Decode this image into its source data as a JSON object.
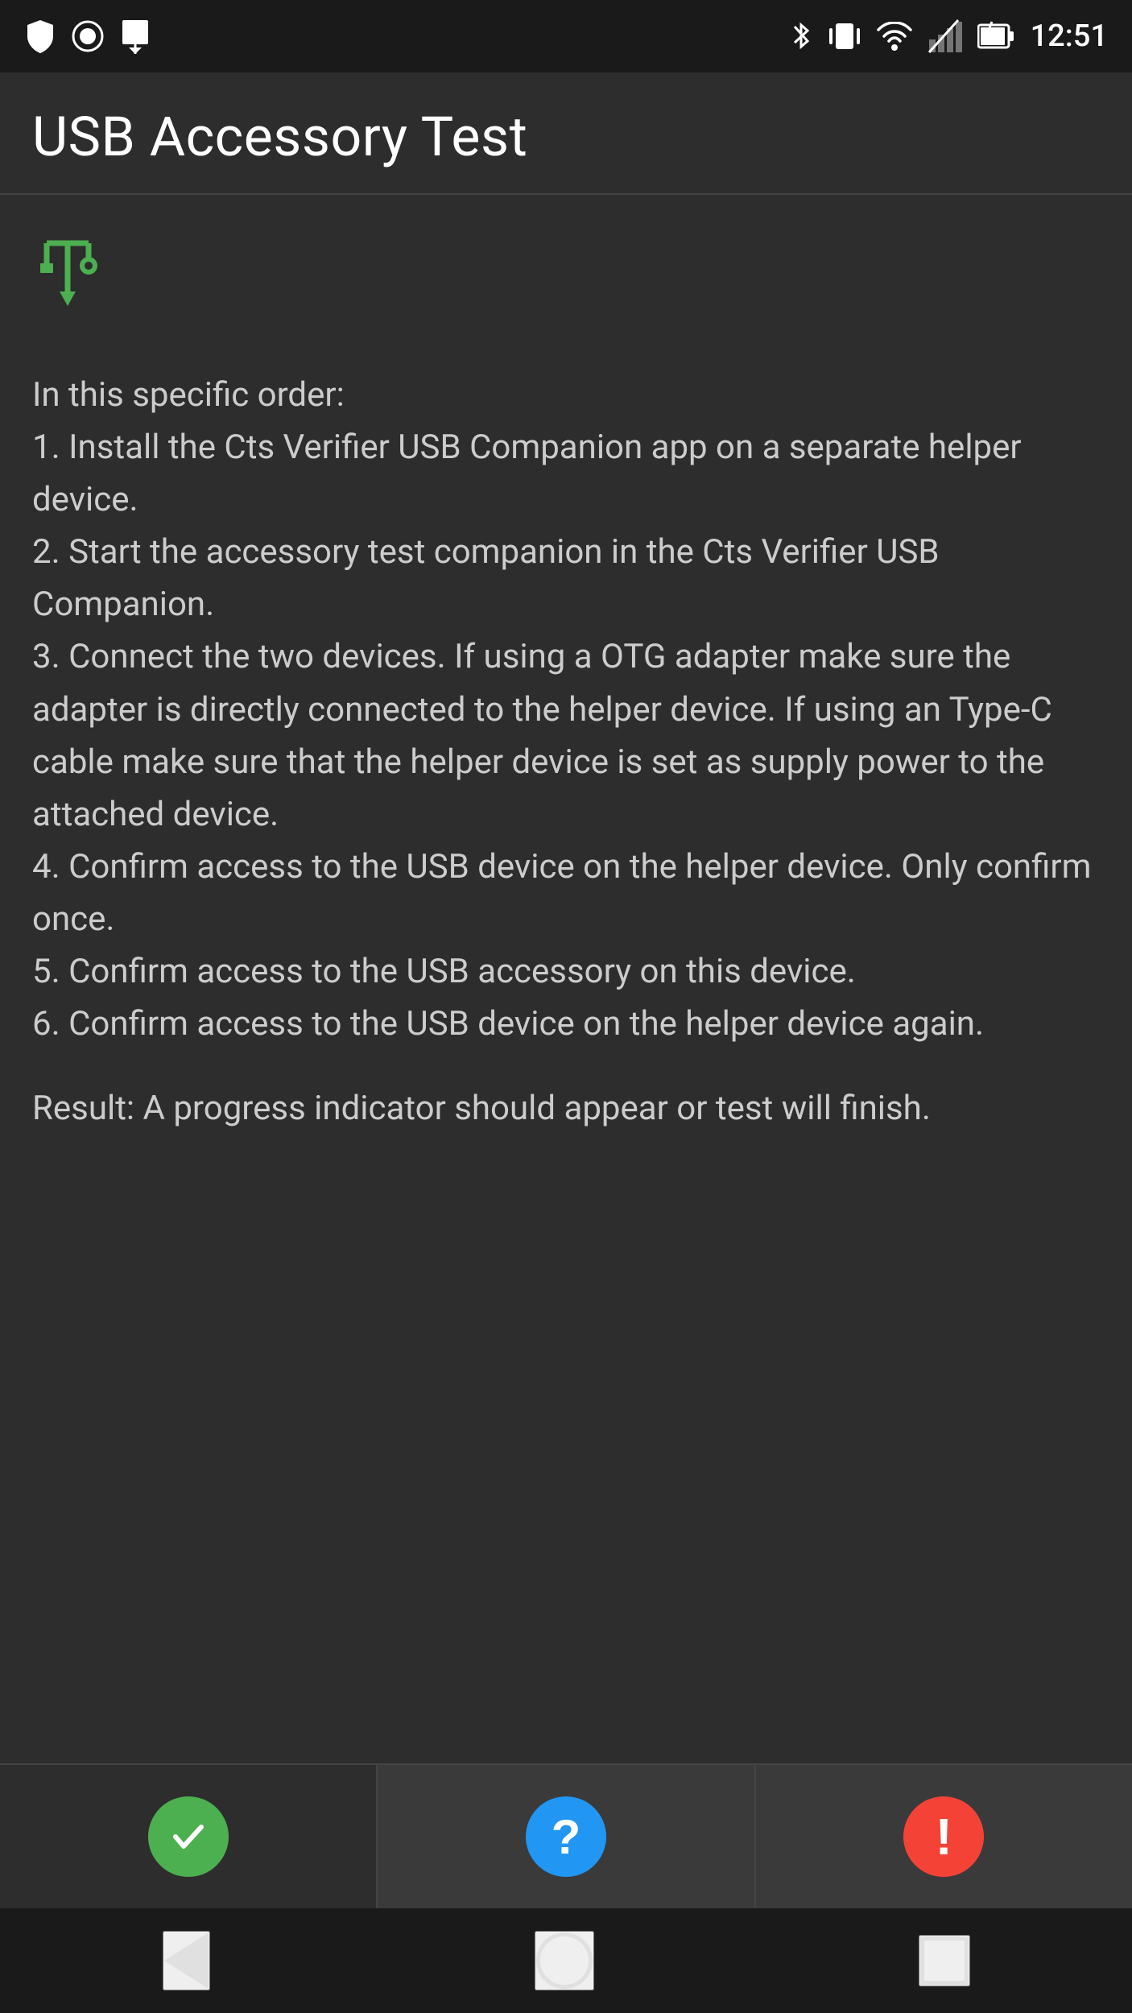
{
  "statusBar": {
    "time": "12:51",
    "leftIcons": [
      "shield",
      "record",
      "download"
    ],
    "rightIcons": [
      "bluetooth",
      "vibrate",
      "wifi",
      "signal",
      "battery"
    ]
  },
  "header": {
    "title": "USB Accessory Test"
  },
  "content": {
    "usbIconLabel": "usb",
    "instructions": "In this specific order:\n1. Install the Cts Verifier USB Companion app on a separate helper device.\n2. Start the accessory test companion in the Cts Verifier USB Companion.\n3. Connect the two devices. If using a OTG adapter make sure the adapter is directly connected to the helper device. If using an Type-C cable make sure that the helper device is set as supply power to the attached device.\n4. Confirm access to the USB device on the helper device. Only confirm once.\n5. Confirm access to the USB accessory on this device.\n6. Confirm access to the USB device on the helper device again.",
    "result": "Result: A progress indicator should appear or test will finish."
  },
  "bottomBar": {
    "passLabel": "✓",
    "infoLabel": "?",
    "failLabel": "!"
  },
  "navBar": {
    "backLabel": "back",
    "homeLabel": "home",
    "recentsLabel": "recents"
  }
}
